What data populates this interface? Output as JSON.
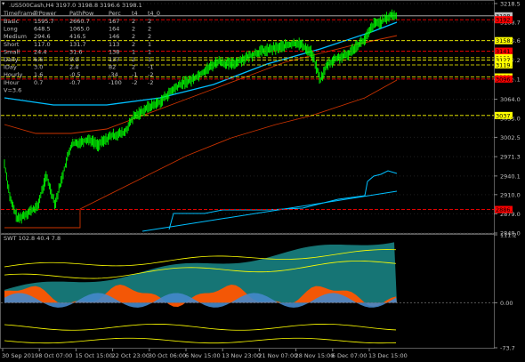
{
  "main_pane": {
    "symbol_header": ".US500Cash,H4  3197.0 3198.8 3196.6 3198.1",
    "table": {
      "headers": [
        "TimeFrame",
        "TrPower",
        "PathPow",
        "Perc",
        "t4",
        "t4_0"
      ],
      "rows": [
        [
          "Basic",
          "1595.7",
          "2660.7",
          "167",
          "2",
          "2"
        ],
        [
          "Long",
          "648.5",
          "1065.0",
          "164",
          "2",
          "2"
        ],
        [
          "Medium",
          "294.6",
          "416.5",
          "146",
          "2",
          "2"
        ],
        [
          "Short",
          "117.0",
          "131.7",
          "113",
          "2",
          "1"
        ],
        [
          "Small",
          "24.4",
          "31.6",
          "138",
          "1",
          "1"
        ],
        [
          "Daily",
          "6.6",
          "9.0",
          "137",
          "2",
          "1"
        ],
        [
          "IDay",
          "3.0",
          "2.4",
          "82",
          "2",
          "-1"
        ],
        [
          "Hourly",
          "1.6",
          "-0.5",
          "-34",
          "-1",
          "-2"
        ],
        [
          "IHour",
          "0.7",
          "-0.7",
          "-100",
          "-2",
          "-2"
        ]
      ],
      "footer": "V=3.6"
    },
    "price_axis": [
      "3218.5",
      "3188.7",
      "3158.6",
      "3127.2",
      "3096.1",
      "3064.0",
      "3033.0",
      "3002.5",
      "2971.3",
      "2940.1",
      "2910.0",
      "2879.0",
      "2848.0"
    ],
    "price_tags": [
      {
        "value": "3198.7",
        "color": "#c0c0c0",
        "text": "#000000"
      },
      {
        "value": "3192.4",
        "color": "#ff0000",
        "text": "#000000"
      },
      {
        "value": "3158.6",
        "color": "#ffff00",
        "text": "#000000"
      },
      {
        "value": "3141.6",
        "color": "#ff0000",
        "text": "#000000"
      },
      {
        "value": "3131.1",
        "color": "#ffff00",
        "text": "#000000"
      },
      {
        "value": "3127.2",
        "color": "#ffff00",
        "text": "#000000"
      },
      {
        "value": "3119.4",
        "color": "#ffff00",
        "text": "#000000"
      },
      {
        "value": "3100.0",
        "color": "#ffff00",
        "text": "#000000"
      },
      {
        "value": "3096.7",
        "color": "#ff0000",
        "text": "#000000"
      },
      {
        "value": "3037.8",
        "color": "#ffff00",
        "text": "#000000"
      },
      {
        "value": "2886.0",
        "color": "#ff0000",
        "text": "#000000"
      }
    ]
  },
  "indicator_pane": {
    "header": "SWT 102.8 40.4 7.8",
    "axis": [
      "111.2",
      "0.00",
      "-73.7"
    ]
  },
  "time_axis": [
    "30 Sep 2019",
    "8 Oct 07:00",
    "15 Oct 15:00",
    "22 Oct 23:00",
    "30 Oct 06:00",
    "6 Nov 15:00",
    "13 Nov 23:00",
    "21 Nov 07:00",
    "28 Nov 15:00",
    "6 Dec 07:00",
    "13 Dec 15:00"
  ],
  "colors": {
    "background": "#000000",
    "grid": "#1f1f1f",
    "candles": "#00ff00",
    "ma_blue": "#00bfff",
    "trend_red": "#cc3300",
    "level_yellow": "#ffff00",
    "level_red": "#ff0000",
    "osc_fill_orange": "#ff5500",
    "osc_fill_teal": "#1a8a8a",
    "osc_fill_blue": "#4488cc"
  }
}
